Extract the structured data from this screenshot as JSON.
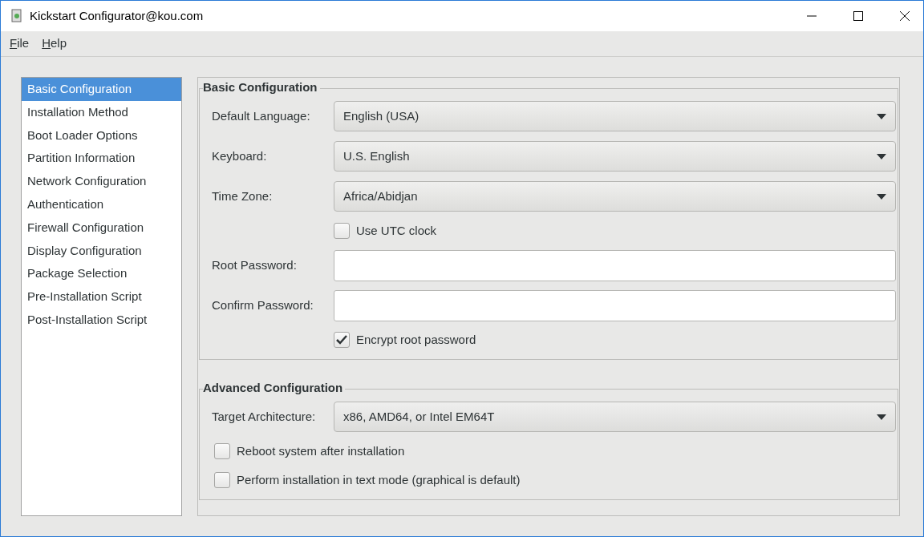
{
  "window": {
    "title": "Kickstart Configurator@kou.com"
  },
  "menu": [
    {
      "label": "File"
    },
    {
      "label": "Help"
    }
  ],
  "sidebar": {
    "items": [
      {
        "label": "Basic Configuration",
        "selected": true
      },
      {
        "label": "Installation Method",
        "selected": false
      },
      {
        "label": "Boot Loader Options",
        "selected": false
      },
      {
        "label": "Partition Information",
        "selected": false
      },
      {
        "label": "Network Configuration",
        "selected": false
      },
      {
        "label": "Authentication",
        "selected": false
      },
      {
        "label": "Firewall Configuration",
        "selected": false
      },
      {
        "label": "Display Configuration",
        "selected": false
      },
      {
        "label": "Package Selection",
        "selected": false
      },
      {
        "label": "Pre-Installation Script",
        "selected": false
      },
      {
        "label": "Post-Installation Script",
        "selected": false
      }
    ]
  },
  "sections": [
    {
      "title": "Basic Configuration",
      "rows": [
        {
          "kind": "combo",
          "label": "Default Language:",
          "value": "English (USA)"
        },
        {
          "kind": "combo",
          "label": "Keyboard:",
          "value": "U.S. English"
        },
        {
          "kind": "combo",
          "label": "Time Zone:",
          "value": "Africa/Abidjan"
        },
        {
          "kind": "check",
          "label": "Use UTC clock",
          "checked": false
        },
        {
          "kind": "password",
          "label": "Root Password:"
        },
        {
          "kind": "password",
          "label": "Confirm Password:"
        },
        {
          "kind": "check",
          "label": "Encrypt root password",
          "checked": true
        }
      ]
    },
    {
      "title": "Advanced Configuration",
      "rows": [
        {
          "kind": "combo",
          "label": "Target Architecture:",
          "value": "x86, AMD64, or Intel EM64T"
        },
        {
          "kind": "wide-check",
          "label": "Reboot system after installation",
          "checked": false
        },
        {
          "kind": "wide-check",
          "label": "Perform installation in text mode (graphical is default)",
          "checked": false
        }
      ]
    }
  ]
}
